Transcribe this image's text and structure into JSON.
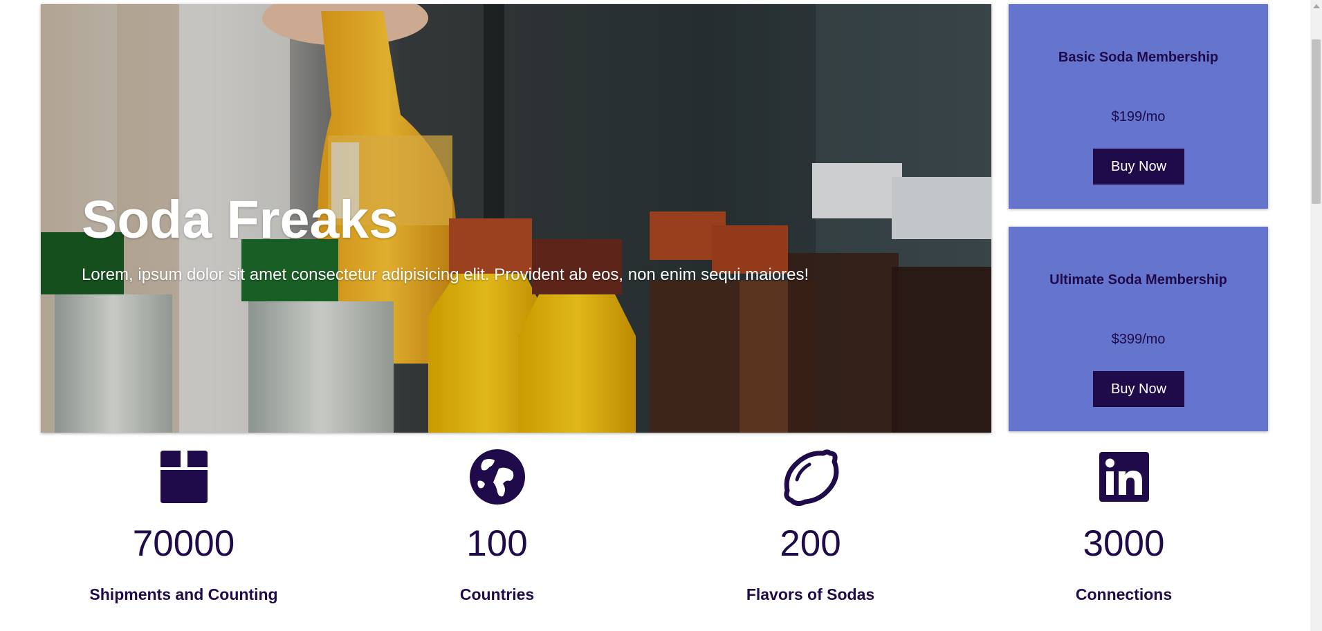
{
  "hero": {
    "title": "Soda Freaks",
    "text": "Lorem, ipsum dolor sit amet consectetur adipisicing elit. Provident ab eos, non enim sequi maiores!"
  },
  "plans": [
    {
      "name": "Basic Soda Membership",
      "price": "$199/mo",
      "button": "Buy Now"
    },
    {
      "name": "Ultimate Soda Membership",
      "price": "$399/mo",
      "button": "Buy Now"
    }
  ],
  "stats": [
    {
      "icon": "box-icon",
      "number": "70000",
      "label": "Shipments and Counting"
    },
    {
      "icon": "globe-icon",
      "number": "100",
      "label": "Countries"
    },
    {
      "icon": "lemon-icon",
      "number": "200",
      "label": "Flavors of Sodas"
    },
    {
      "icon": "linkedin-icon",
      "number": "3000",
      "label": "Connections"
    }
  ],
  "colors": {
    "primary": "#1f0b4a",
    "card": "#6574cd",
    "white": "#ffffff"
  }
}
